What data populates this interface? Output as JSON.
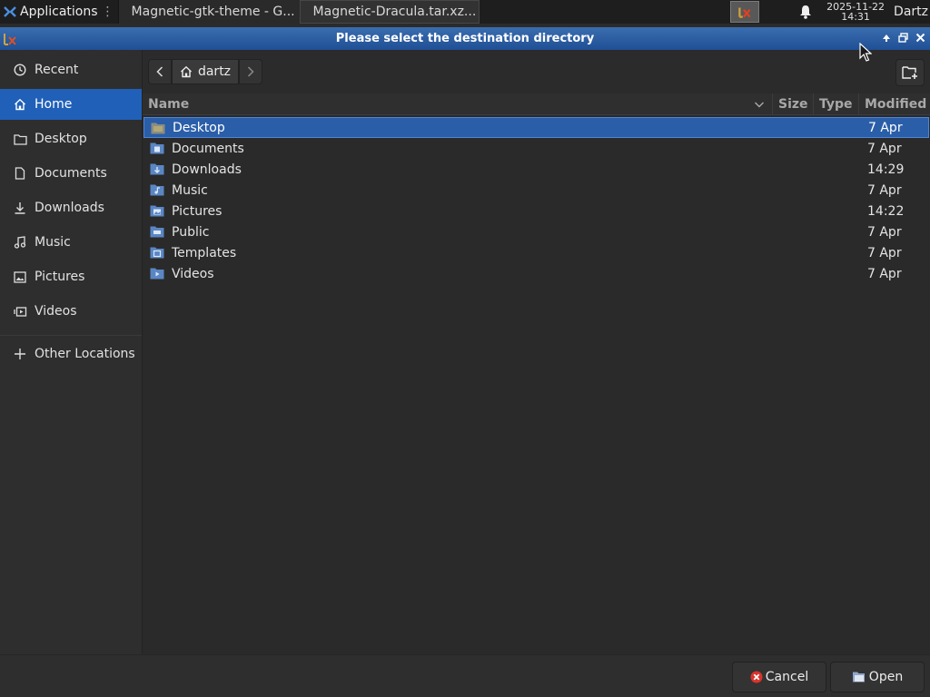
{
  "taskbar": {
    "apps_label": "Applications",
    "tasks": [
      {
        "label": "Magnetic-gtk-theme - G..."
      },
      {
        "label": "Magnetic-Dracula.tar.xz..."
      }
    ],
    "clock_date": "2025-11-22",
    "clock_time": "14:31",
    "user": "Dartz"
  },
  "dialog": {
    "title": "Please select the destination directory"
  },
  "sidebar": {
    "items": [
      {
        "label": "Recent",
        "icon": "clock-icon"
      },
      {
        "label": "Home",
        "icon": "home-icon",
        "active": true
      },
      {
        "label": "Desktop",
        "icon": "folder-icon"
      },
      {
        "label": "Documents",
        "icon": "document-icon"
      },
      {
        "label": "Downloads",
        "icon": "download-icon"
      },
      {
        "label": "Music",
        "icon": "music-icon"
      },
      {
        "label": "Pictures",
        "icon": "picture-icon"
      },
      {
        "label": "Videos",
        "icon": "video-icon"
      },
      {
        "label": "Other Locations",
        "icon": "plus-icon"
      }
    ]
  },
  "pathbar": {
    "crumb": "dartz"
  },
  "columns": {
    "name": "Name",
    "size": "Size",
    "type": "Type",
    "modified": "Modified"
  },
  "files": [
    {
      "name": "Desktop",
      "modified": "7 Apr",
      "selected": true
    },
    {
      "name": "Documents",
      "modified": "7 Apr"
    },
    {
      "name": "Downloads",
      "modified": "14:29"
    },
    {
      "name": "Music",
      "modified": "7 Apr"
    },
    {
      "name": "Pictures",
      "modified": "14:22"
    },
    {
      "name": "Public",
      "modified": "7 Apr"
    },
    {
      "name": "Templates",
      "modified": "7 Apr"
    },
    {
      "name": "Videos",
      "modified": "7 Apr"
    }
  ],
  "buttons": {
    "cancel": "Cancel",
    "open": "Open"
  },
  "colors": {
    "accent": "#2060b8",
    "titlebar": "#2b5ea6",
    "cancel_icon": "#d9342b"
  }
}
